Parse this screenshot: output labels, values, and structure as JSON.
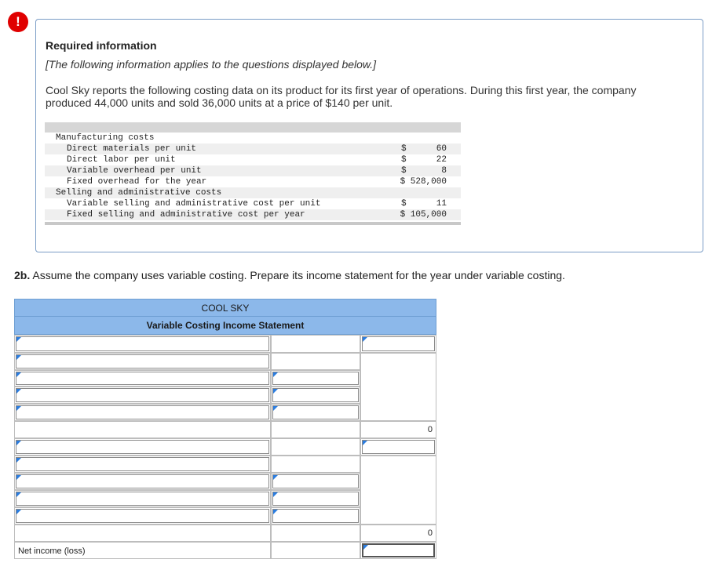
{
  "alert": {
    "icon": "exclamation-icon",
    "glyph": "!"
  },
  "info": {
    "title": "Required information",
    "italic_note": "[The following information applies to the questions displayed below.]",
    "paragraph": "Cool Sky reports the following costing data on its product for its first year of operations. During this first year, the company produced 44,000 units and sold 36,000 units at a price of $140 per unit.",
    "table": [
      {
        "label": "Manufacturing costs",
        "indent": 1,
        "dollar": "",
        "value": ""
      },
      {
        "label": "Direct materials per unit",
        "indent": 2,
        "dollar": "$",
        "value": "60"
      },
      {
        "label": "Direct labor per unit",
        "indent": 2,
        "dollar": "$",
        "value": "22"
      },
      {
        "label": "Variable overhead per unit",
        "indent": 2,
        "dollar": "$",
        "value": "8"
      },
      {
        "label": "Fixed overhead for the year",
        "indent": 2,
        "dollar": "",
        "value": "$ 528,000"
      },
      {
        "label": "Selling and administrative costs",
        "indent": 1,
        "dollar": "",
        "value": ""
      },
      {
        "label": "Variable selling and administrative cost per unit",
        "indent": 2,
        "dollar": "$",
        "value": "11"
      },
      {
        "label": "Fixed selling and administrative cost per year",
        "indent": 2,
        "dollar": "",
        "value": "$ 105,000"
      }
    ]
  },
  "question": {
    "part": "2b.",
    "text": " Assume the company uses variable costing. Prepare its income statement for the year under variable costing."
  },
  "statement": {
    "company": "COOL SKY",
    "title": "Variable Costing Income Statement",
    "subtotal1": "0",
    "subtotal2": "0",
    "net_income_label": "Net income (loss)"
  },
  "colors": {
    "header_bg": "#8cb8ea",
    "alert": "#e00000",
    "input_marker": "#2b7de0",
    "box_border": "#7a9cc6"
  }
}
